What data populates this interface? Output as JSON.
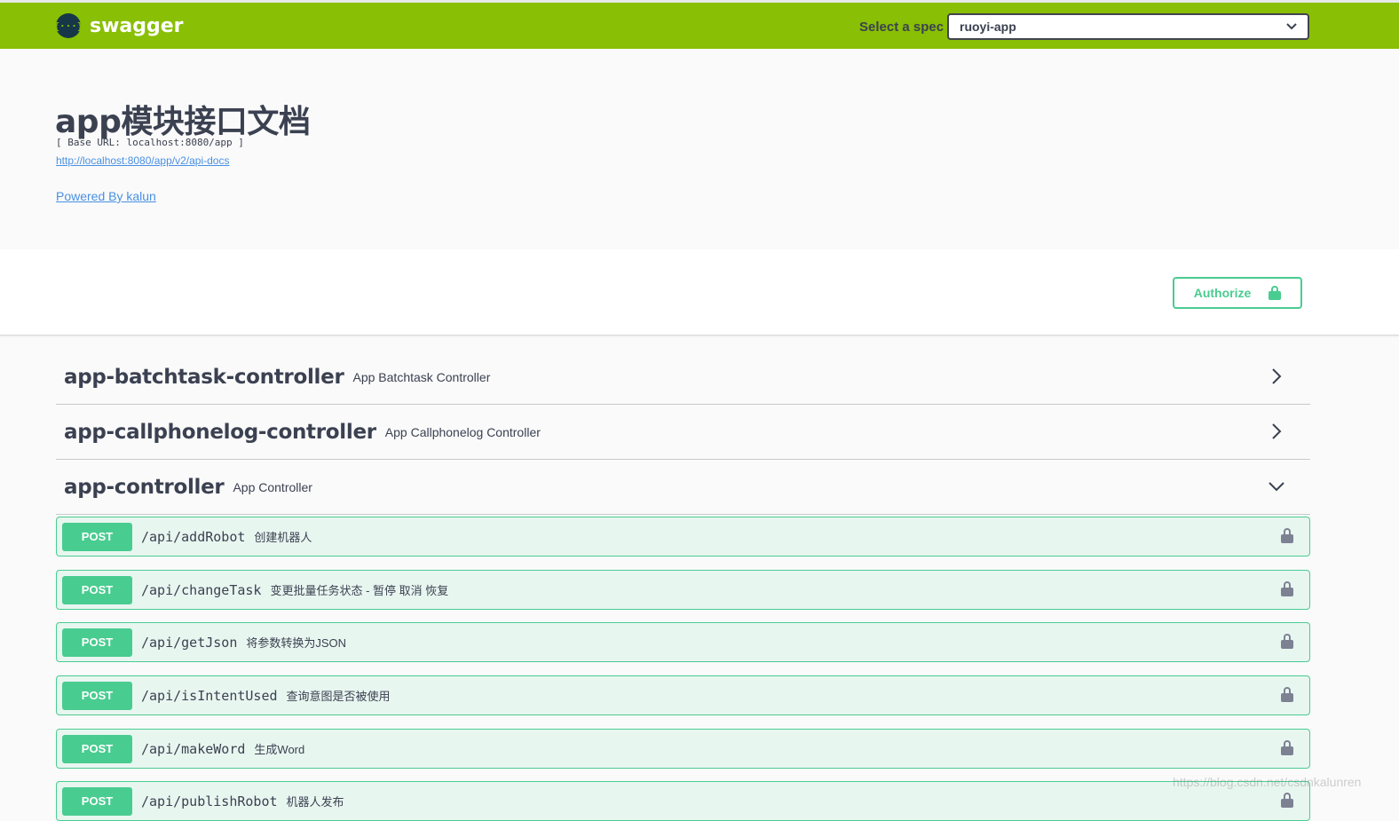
{
  "topbar": {
    "logo_icon": "{···}",
    "logo_text": "swagger",
    "spec_label": "Select a spec",
    "spec_value": "ruoyi-app"
  },
  "info": {
    "title": "app模块接口文档",
    "base_url": "[ Base URL: localhost:8080/app ]",
    "api_docs_link": "http://localhost:8080/app/v2/api-docs",
    "powered_by": "Powered By kalun"
  },
  "authorize": {
    "label": "Authorize"
  },
  "tags": [
    {
      "name": "app-batchtask-controller",
      "description": "App Batchtask Controller",
      "expanded": false
    },
    {
      "name": "app-callphonelog-controller",
      "description": "App Callphonelog Controller",
      "expanded": false
    },
    {
      "name": "app-controller",
      "description": "App Controller",
      "expanded": true
    }
  ],
  "operations": [
    {
      "method": "POST",
      "path": "/api/addRobot",
      "summary": "创建机器人"
    },
    {
      "method": "POST",
      "path": "/api/changeTask",
      "summary": "变更批量任务状态 - 暂停 取消 恢复"
    },
    {
      "method": "POST",
      "path": "/api/getJson",
      "summary": "将参数转换为JSON"
    },
    {
      "method": "POST",
      "path": "/api/isIntentUsed",
      "summary": "查询意图是否被使用"
    },
    {
      "method": "POST",
      "path": "/api/makeWord",
      "summary": "生成Word"
    },
    {
      "method": "POST",
      "path": "/api/publishRobot",
      "summary": "机器人发布"
    }
  ],
  "watermark": "https://blog.csdn.net/csdnkalunren",
  "colors": {
    "topbar": "#89bf04",
    "post": "#49cc90",
    "post_bg": "#e8f6f0",
    "link": "#4990e2"
  }
}
